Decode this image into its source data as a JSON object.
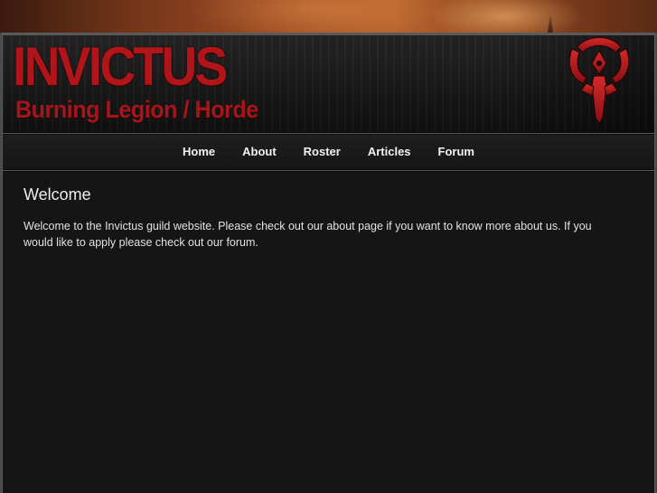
{
  "header": {
    "title": "INVICTUS",
    "subtitle": "Burning Legion / Horde",
    "emblem_icon": "horde-emblem-icon"
  },
  "nav": {
    "items": [
      {
        "label": "Home"
      },
      {
        "label": "About"
      },
      {
        "label": "Roster"
      },
      {
        "label": "Articles"
      },
      {
        "label": "Forum"
      }
    ]
  },
  "main": {
    "heading": "Welcome",
    "body": "Welcome to the Invictus guild website. Please check out our about page if you want to know more about us. If you would like to apply please check out our forum."
  },
  "colors": {
    "brand_red": "#b0151a",
    "nav_text": "#f2f2f2",
    "content_bg": "#151515",
    "frame_gray": "#5a5a5a"
  }
}
